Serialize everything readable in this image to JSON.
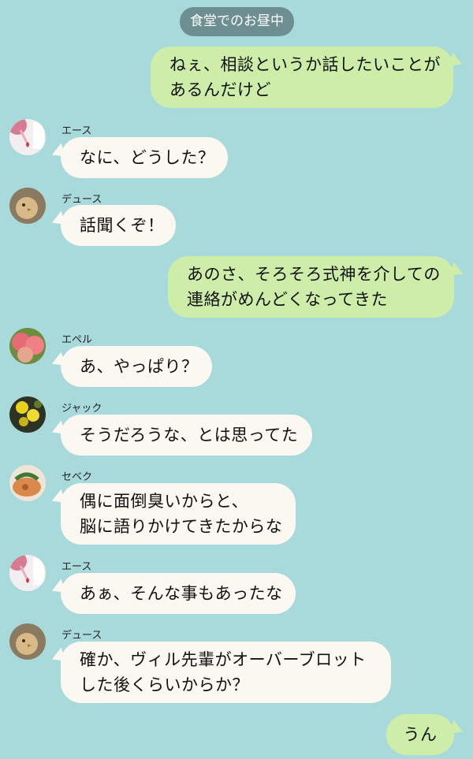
{
  "header": {
    "label": "食堂でのお昼中"
  },
  "messages": [
    {
      "side": "out",
      "lines": [
        "ねぇ、相談というか話したいことが",
        "あるんだけど"
      ]
    },
    {
      "side": "in",
      "name": "エース",
      "avatar": "ace-avatar",
      "lines": [
        "なに、どうした？"
      ]
    },
    {
      "side": "in",
      "name": "デュース",
      "avatar": "deuce-avatar",
      "lines": [
        "話聞くぞ！"
      ]
    },
    {
      "side": "out",
      "lines": [
        "あのさ、そろそろ式神を介しての",
        "連絡がめんどくなってきた"
      ]
    },
    {
      "side": "in",
      "name": "エペル",
      "avatar": "epel-avatar",
      "lines": [
        "あ、やっぱり？"
      ]
    },
    {
      "side": "in",
      "name": "ジャック",
      "avatar": "jack-avatar",
      "lines": [
        "そうだろうな、とは思ってた"
      ]
    },
    {
      "side": "in",
      "name": "セベク",
      "avatar": "sebek-avatar",
      "lines": [
        "偶に面倒臭いからと、",
        "脳に語りかけてきたからな"
      ]
    },
    {
      "side": "in",
      "name": "エース",
      "avatar": "ace-avatar",
      "lines": [
        "あぁ、そんな事もあったな"
      ]
    },
    {
      "side": "in",
      "name": "デュース",
      "avatar": "deuce-avatar",
      "lines": [
        "確か、ヴィル先輩がオーバーブロット",
        "した後くらいからか？"
      ]
    },
    {
      "side": "out",
      "lines": [
        "うん"
      ]
    }
  ]
}
